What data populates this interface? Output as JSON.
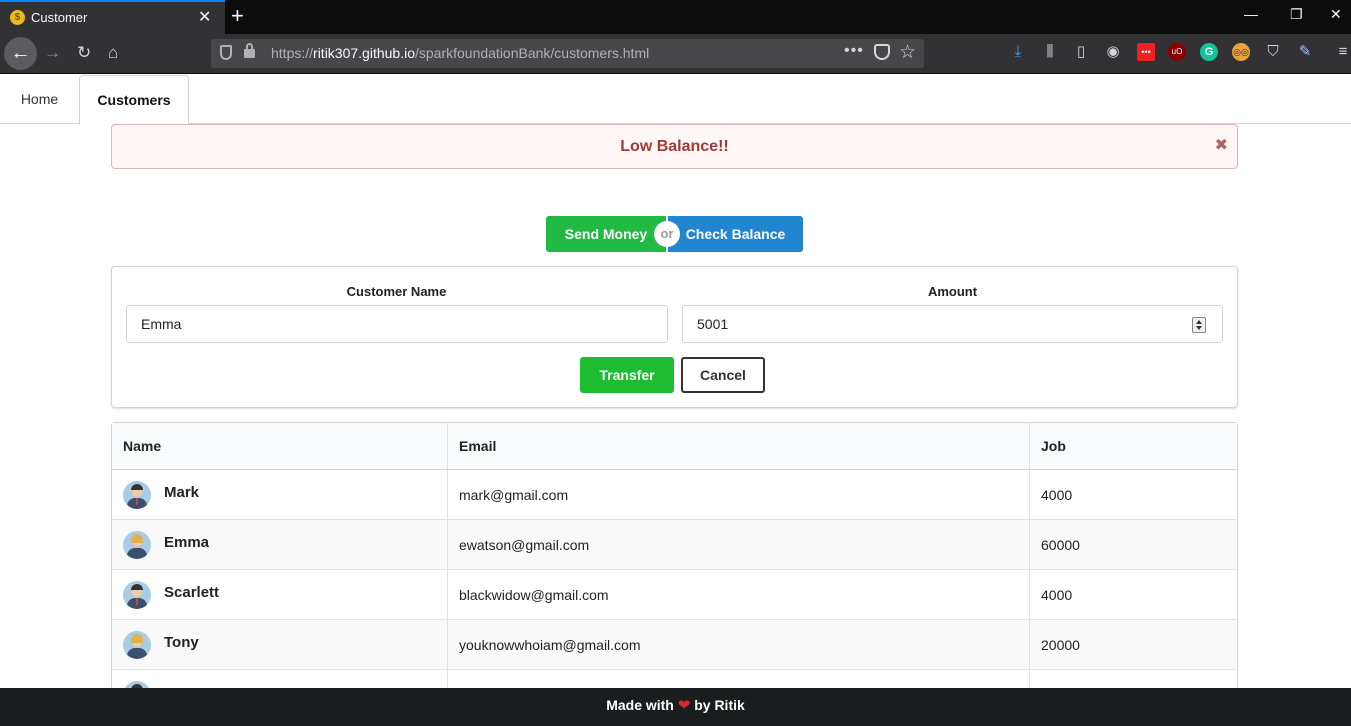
{
  "browser": {
    "tab_title": "Customer",
    "tab_favicon_glyph": "$",
    "url_prefix": "https://",
    "url_host": "ritik307.github.io",
    "url_path": "/sparkfoundationBank/customers.html"
  },
  "menu": {
    "home_label": "Home",
    "customers_label": "Customers"
  },
  "alert": {
    "message": "Low Balance!!",
    "close_glyph": "✖"
  },
  "actions": {
    "send_label": "Send Money",
    "or_label": "or",
    "check_label": "Check Balance"
  },
  "form": {
    "name_label": "Customer Name",
    "name_value": "Emma",
    "amount_label": "Amount",
    "amount_value": "5001",
    "transfer_label": "Transfer",
    "cancel_label": "Cancel"
  },
  "table": {
    "headers": {
      "name": "Name",
      "email": "Email",
      "job": "Job"
    },
    "rows": [
      {
        "name": "Mark",
        "email": "mark@gmail.com",
        "job": "4000",
        "avatar": "male"
      },
      {
        "name": "Emma",
        "email": "ewatson@gmail.com",
        "job": "60000",
        "avatar": "female"
      },
      {
        "name": "Scarlett",
        "email": "blackwidow@gmail.com",
        "job": "4000",
        "avatar": "male"
      },
      {
        "name": "Tony",
        "email": "youknowwhoiam@gmail.com",
        "job": "20000",
        "avatar": "female"
      }
    ]
  },
  "footer": {
    "prefix": "Made with",
    "heart": "❤",
    "suffix": "by Ritik"
  },
  "colors": {
    "send": "#21ba45",
    "check": "#2185d0",
    "transfer": "#1ebc30",
    "alert_text": "#9f3a38",
    "footer_bg": "#1b1c1d"
  }
}
